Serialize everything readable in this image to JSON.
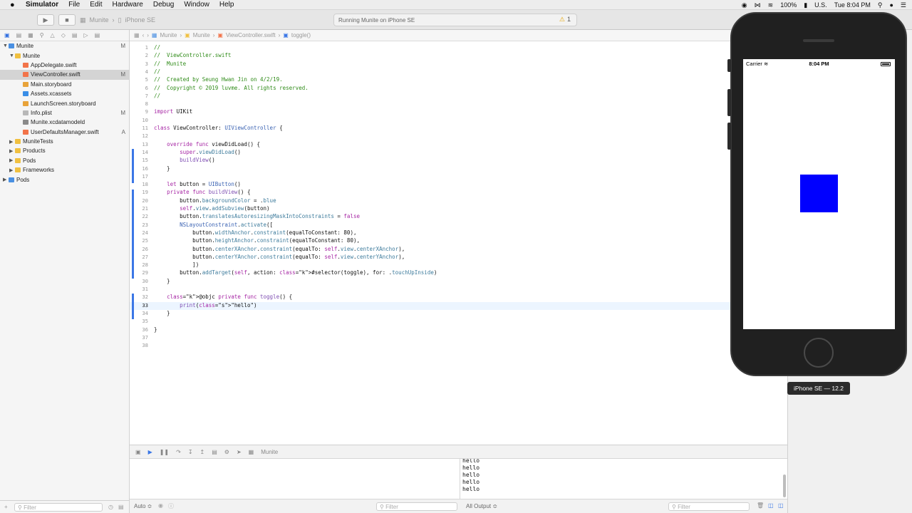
{
  "menubar": {
    "app_name": "Simulator",
    "items": [
      "File",
      "Edit",
      "Hardware",
      "Debug",
      "Window",
      "Help"
    ],
    "status": {
      "battery": "100%",
      "input_source": "U.S.",
      "clock": "Tue 8:04 PM"
    }
  },
  "toolbar": {
    "scheme": "Munite",
    "device": "iPhone SE",
    "activity_status": "Running Munite on iPhone SE",
    "warning_count": "1"
  },
  "navigator": {
    "items": [
      {
        "label": "Munite",
        "badge": "M",
        "disclosure": "▼"
      },
      {
        "label": "Munite",
        "badge": "",
        "disclosure": "▼"
      },
      {
        "label": "AppDelegate.swift",
        "badge": ""
      },
      {
        "label": "ViewController.swift",
        "badge": "M"
      },
      {
        "label": "Main.storyboard",
        "badge": ""
      },
      {
        "label": "Assets.xcassets",
        "badge": ""
      },
      {
        "label": "LaunchScreen.storyboard",
        "badge": ""
      },
      {
        "label": "Info.plist",
        "badge": "M"
      },
      {
        "label": "Munite.xcdatamodeld",
        "badge": ""
      },
      {
        "label": "UserDefaultsManager.swift",
        "badge": "A"
      },
      {
        "label": "MuniteTests",
        "badge": "",
        "disclosure": "▶"
      },
      {
        "label": "Products",
        "badge": "",
        "disclosure": "▶"
      },
      {
        "label": "Pods",
        "badge": "",
        "disclosure": "▶"
      },
      {
        "label": "Frameworks",
        "badge": "",
        "disclosure": "▶"
      },
      {
        "label": "Pods",
        "badge": "",
        "disclosure": "▶"
      }
    ],
    "filter_placeholder": "Filter"
  },
  "jumpbar": {
    "crumbs": [
      "Munite",
      "Munite",
      "ViewController.swift",
      "toggle()"
    ]
  },
  "editor": {
    "current_line": 33,
    "lines": [
      "//",
      "//  ViewController.swift",
      "//  Munite",
      "//",
      "//  Created by Seung Hwan Jin on 4/2/19.",
      "//  Copyright © 2019 luvme. All rights reserved.",
      "//",
      "",
      "import UIKit",
      "",
      "class ViewController: UIViewController {",
      "",
      "    override func viewDidLoad() {",
      "        super.viewDidLoad()",
      "        buildView()",
      "    }",
      "",
      "    let button = UIButton()",
      "    private func buildView() {",
      "        button.backgroundColor = .blue",
      "        self.view.addSubview(button)",
      "        button.translatesAutoresizingMaskIntoConstraints = false",
      "        NSLayoutConstraint.activate([",
      "            button.widthAnchor.constraint(equalToConstant: 80),",
      "            button.heightAnchor.constraint(equalToConstant: 80),",
      "            button.centerXAnchor.constraint(equalTo: self.view.centerXAnchor),",
      "            button.centerYAnchor.constraint(equalTo: self.view.centerYAnchor),",
      "            ])",
      "        button.addTarget(self, action: #selector(toggle), for: .touchUpInside)",
      "    }",
      "",
      "    @objc private func toggle() {",
      "        print(\"hello\")",
      "    }",
      "",
      "}",
      "",
      ""
    ]
  },
  "debug": {
    "process": "Munite",
    "console_lines": [
      "hello",
      "hello",
      "hello",
      "hello",
      "hello"
    ],
    "variables_scope": "Auto ≎",
    "output_scope": "All Output ≎",
    "filter_placeholder": "Filter"
  },
  "simulator": {
    "carrier": "Carrier",
    "time": "8:04 PM",
    "device_label": "iPhone SE — 12.2",
    "button_color": "#0000ff"
  }
}
